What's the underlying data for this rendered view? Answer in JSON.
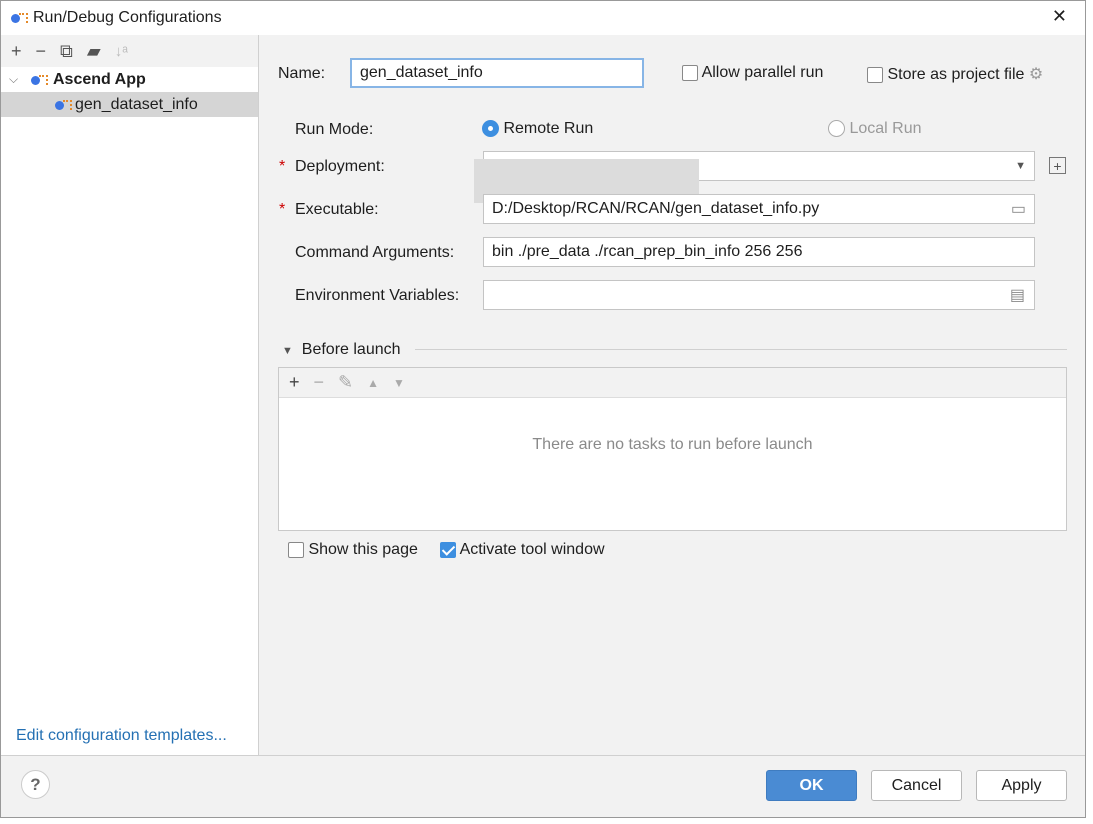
{
  "window": {
    "title": "Run/Debug Configurations",
    "close": "✕"
  },
  "sidebar": {
    "toolbar": [
      "+",
      "−",
      "⧉",
      "▰",
      "↓ᵃ"
    ],
    "tree": [
      {
        "label": "Ascend App",
        "expanded": true
      },
      {
        "label": "gen_dataset_info",
        "selected": true
      }
    ],
    "edit_templates": "Edit configuration templates..."
  },
  "form": {
    "name_label": "Name:",
    "name_value": "gen_dataset_info",
    "allow_parallel": {
      "label": "Allow parallel run",
      "checked": false
    },
    "store_project": {
      "label": "Store as project file",
      "checked": false
    },
    "run_mode_label": "Run Mode:",
    "remote_run": "Remote Run",
    "local_run": "Local Run",
    "run_mode_selected": "Remote Run",
    "deployment_label": "Deployment:",
    "deployment_value": "",
    "executable_label": "Executable:",
    "executable_value": "D:/Desktop/RCAN/RCAN/gen_dataset_info.py",
    "args_label": "Command Arguments:",
    "args_value": "bin ./pre_data ./rcan_prep_bin_info 256 256",
    "env_label": "Environment Variables:",
    "env_value": "",
    "required_mark": "*"
  },
  "before_launch": {
    "title": "Before launch",
    "empty": "There are no tasks to run before launch",
    "show_page": {
      "label": "Show this page",
      "checked": false
    },
    "activate_tool": {
      "label": "Activate tool window",
      "checked": true
    }
  },
  "footer": {
    "help": "?",
    "ok": "OK",
    "cancel": "Cancel",
    "apply": "Apply"
  }
}
